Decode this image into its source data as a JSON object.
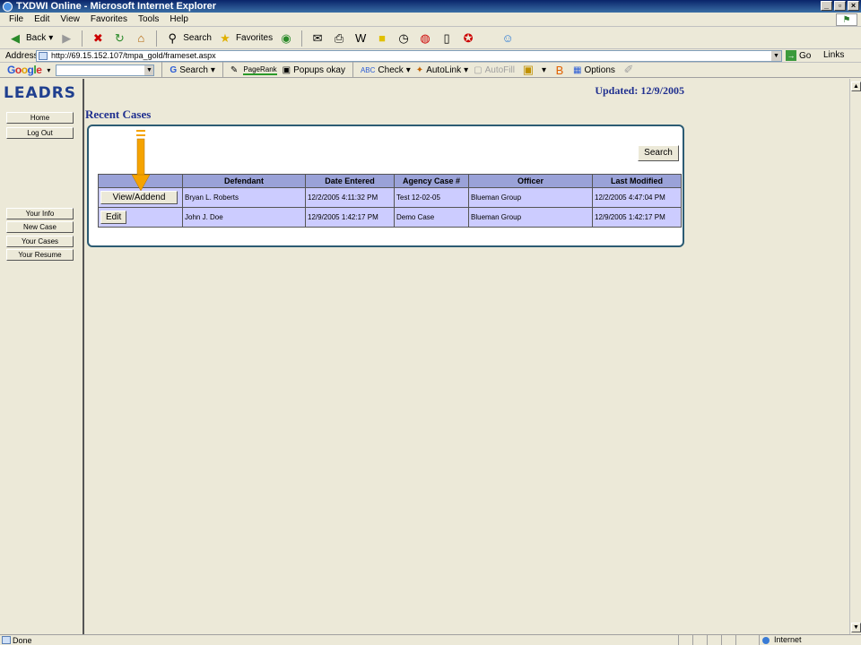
{
  "window": {
    "title": "TXDWI Online - Microsoft Internet Explorer"
  },
  "menu": [
    "File",
    "Edit",
    "View",
    "Favorites",
    "Tools",
    "Help"
  ],
  "toolbar": {
    "back": "Back",
    "search": "Search",
    "favorites": "Favorites"
  },
  "address": {
    "label": "Address",
    "url": "http://69.15.152.107/tmpa_gold/frameset.aspx",
    "go": "Go",
    "links": "Links"
  },
  "google": {
    "logo": "Google",
    "search": "Search",
    "pagerank": "PageRank",
    "popups": "Popups okay",
    "check": "Check",
    "autolink": "AutoLink",
    "autofill": "AutoFill",
    "options": "Options"
  },
  "nav": {
    "logo": "LEADRS",
    "items": [
      "Home",
      "Log Out",
      "Your Info",
      "New Case",
      "Your Cases",
      "Your Resume"
    ]
  },
  "main": {
    "updated": "Updated: 12/9/2005",
    "heading": "Recent Cases",
    "search_button": "Search",
    "columns": [
      "",
      "Defendant",
      "Date Entered",
      "Agency Case #",
      "Officer",
      "Last Modified"
    ],
    "rows": [
      {
        "action": "View/Addend",
        "defendant": "Bryan L. Roberts",
        "date_entered": "12/2/2005 4:11:32 PM",
        "case_no": "Test 12-02-05",
        "officer": "Blueman Group",
        "last_modified": "12/2/2005 4:47:04 PM"
      },
      {
        "action": "Edit",
        "defendant": "John J. Doe",
        "date_entered": "12/9/2005 1:42:17 PM",
        "case_no": "Demo Case",
        "officer": "Blueman Group",
        "last_modified": "12/9/2005 1:42:17 PM"
      }
    ]
  },
  "status": {
    "text": "Done",
    "zone": "Internet"
  },
  "colors": {
    "accent_arrow": "#f5a300",
    "heading": "#1f2f8f",
    "table_header": "#9aa2d8",
    "table_row": "#ccccff",
    "panel_border": "#2c5b73"
  },
  "icons": [
    "ie-icon",
    "back-icon",
    "forward-icon",
    "stop-icon",
    "refresh-icon",
    "home-icon",
    "search-icon",
    "favorites-icon",
    "media-icon",
    "mail-icon",
    "print-icon",
    "edit-icon",
    "page-icon",
    "globe-icon"
  ]
}
